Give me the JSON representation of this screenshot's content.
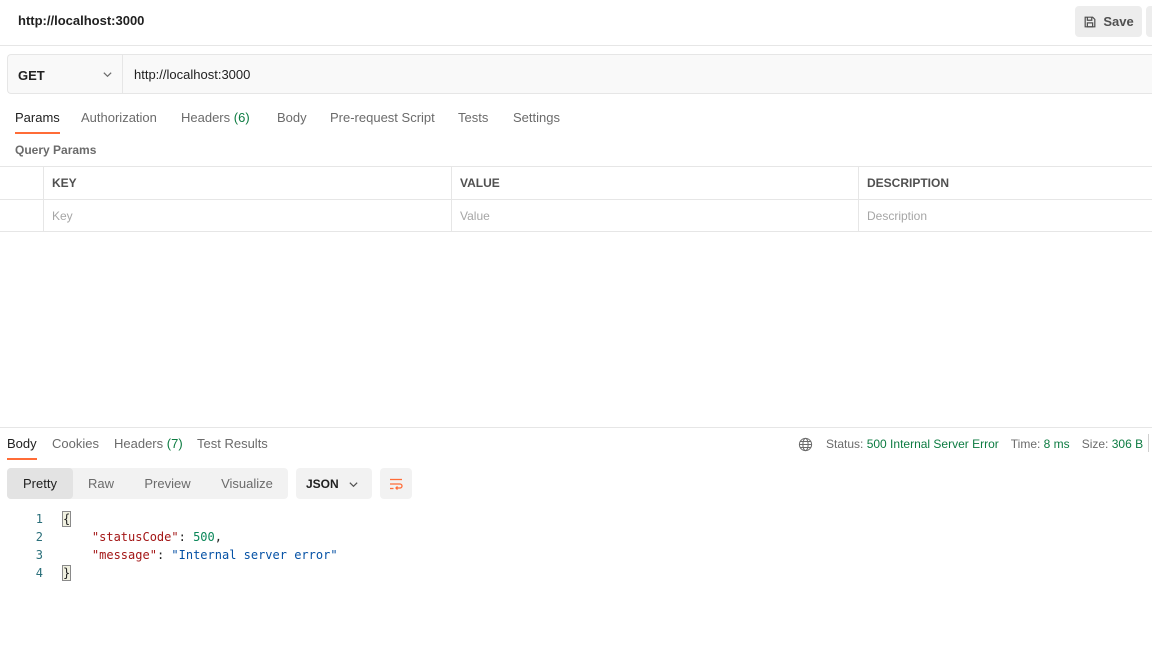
{
  "header": {
    "title": "http://localhost:3000",
    "save_label": "Save"
  },
  "request": {
    "method": "GET",
    "url": "http://localhost:3000"
  },
  "request_tabs": {
    "params": "Params",
    "authorization": "Authorization",
    "headers": "Headers",
    "headers_count": "(6)",
    "body": "Body",
    "pre_request": "Pre-request Script",
    "tests": "Tests",
    "settings": "Settings"
  },
  "query_params": {
    "title": "Query Params",
    "columns": [
      "KEY",
      "VALUE",
      "DESCRIPTION"
    ],
    "placeholders": [
      "Key",
      "Value",
      "Description"
    ]
  },
  "response_tabs": {
    "body": "Body",
    "cookies": "Cookies",
    "headers": "Headers",
    "headers_count": "(7)",
    "test_results": "Test Results"
  },
  "status": {
    "status_label": "Status:",
    "status_value": "500 Internal Server Error",
    "time_label": "Time:",
    "time_value": "8 ms",
    "size_label": "Size:",
    "size_value": "306 B"
  },
  "format": {
    "options": [
      "Pretty",
      "Raw",
      "Preview",
      "Visualize"
    ],
    "selected": "Pretty",
    "language": "JSON"
  },
  "response_body": {
    "line_numbers": [
      "1",
      "2",
      "3",
      "4"
    ],
    "open_brace": "{",
    "close_brace": "}",
    "key1": "\"statusCode\"",
    "val1": "500",
    "key2": "\"message\"",
    "val2": "\"Internal server error\""
  },
  "colors": {
    "accent": "#ff6c37",
    "success_text": "#0c7b41"
  }
}
